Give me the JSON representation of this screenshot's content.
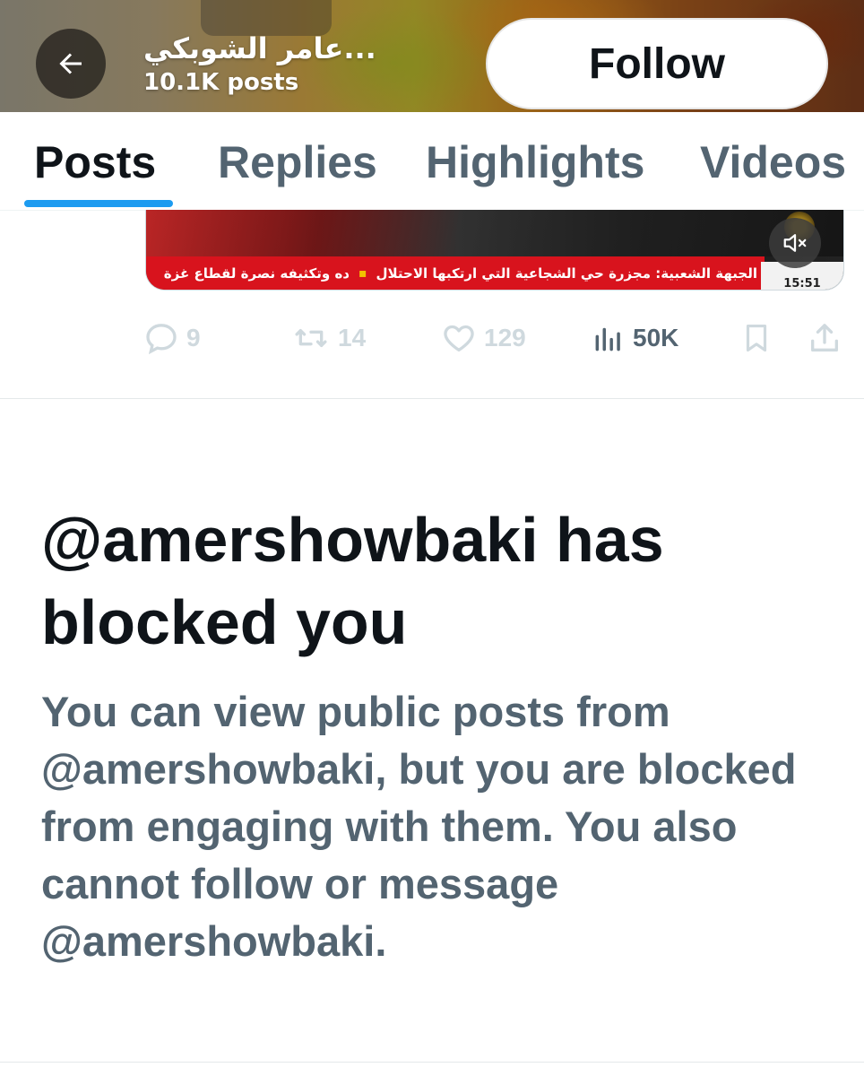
{
  "header": {
    "display_name": "عامر الشوبكي...",
    "post_count": "10.1K posts",
    "follow_label": "Follow",
    "back_icon": "arrow-left-icon"
  },
  "tabs": [
    {
      "label": "Posts",
      "active": true
    },
    {
      "label": "Replies",
      "active": false
    },
    {
      "label": "Highlights",
      "active": false
    },
    {
      "label": "Videos",
      "active": false
    }
  ],
  "media": {
    "ticker_left": "ده وتكثيفه نصرة لقطاع غزة",
    "ticker_right": "الجبهة الشعبية: مجزرة حي الشجاعية التي ارتكبها الاحتلال",
    "clock": "15:51",
    "mute_icon": "speaker-muted-icon"
  },
  "actions": {
    "replies": "9",
    "reposts": "14",
    "likes": "129",
    "views": "50K"
  },
  "blocked": {
    "title": "@amershowbaki has blocked you",
    "body": "You can view public posts from @amershowbaki, but you are blocked from engaging with them. You also cannot follow or message @amershowbaki."
  },
  "colors": {
    "accent": "#1d9bf0",
    "primary_text": "#0f1419",
    "secondary_text": "#536471",
    "ticker_red": "#d8131d"
  }
}
